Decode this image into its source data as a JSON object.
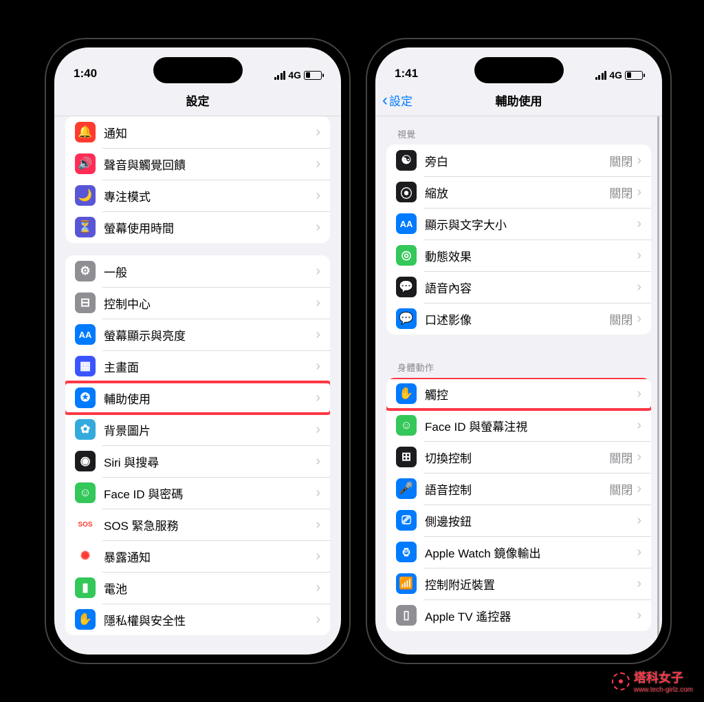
{
  "watermark": {
    "brand": "塔科女子",
    "url": "www.tech-girlz.com"
  },
  "left": {
    "time": "1:40",
    "network": "4G",
    "title": "設定",
    "groups": [
      {
        "id": "g1",
        "rows": [
          {
            "id": "notifications",
            "label": "通知",
            "icon_bg": "#ff3b30",
            "icon_glyph": "🔔"
          },
          {
            "id": "sounds",
            "label": "聲音與觸覺回饋",
            "icon_bg": "#ff2d55",
            "icon_glyph": "🔊"
          },
          {
            "id": "focus",
            "label": "專注模式",
            "icon_bg": "#5856d6",
            "icon_glyph": "🌙"
          },
          {
            "id": "screen-time",
            "label": "螢幕使用時間",
            "icon_bg": "#5856d6",
            "icon_glyph": "⏳"
          }
        ]
      },
      {
        "id": "g2",
        "rows": [
          {
            "id": "general",
            "label": "一般",
            "icon_bg": "#8e8e93",
            "icon_glyph": "⚙︎"
          },
          {
            "id": "control-center",
            "label": "控制中心",
            "icon_bg": "#8e8e93",
            "icon_glyph": "⊟"
          },
          {
            "id": "display",
            "label": "螢幕顯示與亮度",
            "icon_bg": "#007aff",
            "icon_glyph": "AA"
          },
          {
            "id": "home-screen",
            "label": "主畫面",
            "icon_bg": "#3a55ff",
            "icon_glyph": "▦"
          },
          {
            "id": "accessibility",
            "label": "輔助使用",
            "icon_bg": "#007aff",
            "icon_glyph": "✪",
            "highlight": true
          },
          {
            "id": "wallpaper",
            "label": "背景圖片",
            "icon_bg": "#34aadc",
            "icon_glyph": "✿"
          },
          {
            "id": "siri",
            "label": "Siri 與搜尋",
            "icon_bg": "#1c1c1e",
            "icon_glyph": "◉"
          },
          {
            "id": "face-id",
            "label": "Face ID 與密碼",
            "icon_bg": "#34c759",
            "icon_glyph": "☺︎"
          },
          {
            "id": "sos",
            "label": "SOS 緊急服務",
            "icon_bg": "#ffffff",
            "icon_fg": "#ff3b30",
            "icon_glyph": "SOS"
          },
          {
            "id": "exposure",
            "label": "暴露通知",
            "icon_bg": "#ffffff",
            "icon_fg": "#ff3b30",
            "icon_glyph": "✺"
          },
          {
            "id": "battery",
            "label": "電池",
            "icon_bg": "#34c759",
            "icon_glyph": "▮"
          },
          {
            "id": "privacy",
            "label": "隱私權與安全性",
            "icon_bg": "#007aff",
            "icon_glyph": "✋"
          }
        ]
      }
    ]
  },
  "right": {
    "time": "1:41",
    "network": "4G",
    "back_label": "設定",
    "title": "輔助使用",
    "sections": [
      {
        "header": "視覺",
        "rows": [
          {
            "id": "voiceover",
            "label": "旁白",
            "value": "關閉",
            "icon_bg": "#1c1c1e",
            "icon_glyph": "☯︎"
          },
          {
            "id": "zoom",
            "label": "縮放",
            "value": "關閉",
            "icon_bg": "#1c1c1e",
            "icon_glyph": "⦿"
          },
          {
            "id": "display-text",
            "label": "顯示與文字大小",
            "icon_bg": "#007aff",
            "icon_glyph": "AA"
          },
          {
            "id": "motion",
            "label": "動態效果",
            "icon_bg": "#34c759",
            "icon_glyph": "◎"
          },
          {
            "id": "spoken",
            "label": "語音內容",
            "icon_bg": "#1c1c1e",
            "icon_glyph": "💬"
          },
          {
            "id": "audio-desc",
            "label": "口述影像",
            "value": "關閉",
            "icon_bg": "#007aff",
            "icon_glyph": "💬"
          }
        ]
      },
      {
        "header": "身體動作",
        "rows": [
          {
            "id": "touch",
            "label": "觸控",
            "icon_bg": "#007aff",
            "icon_glyph": "✋",
            "highlight": true
          },
          {
            "id": "face-attn",
            "label": "Face ID 與螢幕注視",
            "icon_bg": "#34c759",
            "icon_glyph": "☺︎"
          },
          {
            "id": "switch-ctrl",
            "label": "切換控制",
            "value": "關閉",
            "icon_bg": "#1c1c1e",
            "icon_glyph": "⊞"
          },
          {
            "id": "voice-ctrl",
            "label": "語音控制",
            "value": "關閉",
            "icon_bg": "#007aff",
            "icon_glyph": "🎤"
          },
          {
            "id": "side-button",
            "label": "側邊按鈕",
            "icon_bg": "#007aff",
            "icon_glyph": "⎚"
          },
          {
            "id": "apple-watch",
            "label": "Apple Watch 鏡像輸出",
            "icon_bg": "#007aff",
            "icon_glyph": "⌚︎"
          },
          {
            "id": "nearby",
            "label": "控制附近裝置",
            "icon_bg": "#007aff",
            "icon_glyph": "📶"
          },
          {
            "id": "appletv",
            "label": "Apple TV 遙控器",
            "icon_bg": "#8e8e93",
            "icon_glyph": "▯"
          }
        ]
      }
    ]
  }
}
